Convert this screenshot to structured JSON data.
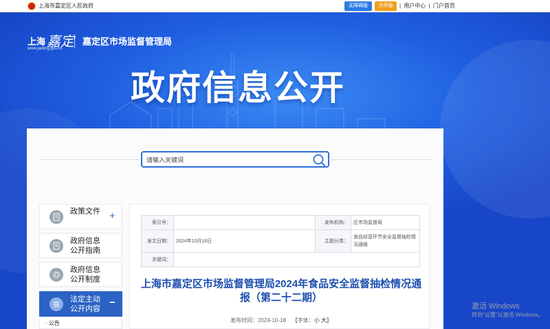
{
  "topbar": {
    "gov_name": "上海市嘉定区人民政府",
    "accessibility_btn": "无障碍版",
    "care_btn": "关怀版",
    "links": [
      "用户中心",
      "门户首页"
    ],
    "separator": "|"
  },
  "logo": {
    "shanghai": "上海",
    "jiading": "嘉定",
    "site": "www.jiading.gov.cn",
    "bureau": "嘉定区市场监督管理局"
  },
  "hero": {
    "title": "政府信息公开"
  },
  "search": {
    "placeholder": "请输入关键词"
  },
  "sidebar": {
    "items": [
      {
        "line1": "政策文件",
        "line2": "",
        "toggle": "+"
      },
      {
        "line1": "政府信息",
        "line2": "公开指南",
        "toggle": ""
      },
      {
        "line1": "政府信息",
        "line2": "公开制度",
        "toggle": ""
      },
      {
        "line1": "法定主动",
        "line2": "公开内容",
        "toggle": "−"
      }
    ],
    "sub_item": "· 公告"
  },
  "info_table": {
    "index_label": "索引号：",
    "index_value": "",
    "publisher_label": "发布机构：",
    "publisher_value": "区市场监督局",
    "date_label": "发文日期：",
    "date_value": "2024年10月18日",
    "topic_label": "主题分类：",
    "topic_value": "食品经营环节安全监督抽检情况通报",
    "keyword_label": "关键词：",
    "keyword_value": ""
  },
  "document": {
    "title": "上海市嘉定区市场监督管理局2024年食品安全监督抽检情况通报（第二十二期）",
    "published_label": "发布时间：",
    "published": "2024-10-18",
    "font_label": "【字体：",
    "font_small": "小",
    "font_large": "大",
    "font_close": "】"
  },
  "watermark": {
    "line1": "激活 Windows",
    "line2": "转到\"设置\"以激活 Windows。"
  },
  "colors": {
    "primary": "#1f5fe0",
    "accent": "#2b62c4",
    "title": "#1c4fae",
    "care": "#f0a020"
  }
}
